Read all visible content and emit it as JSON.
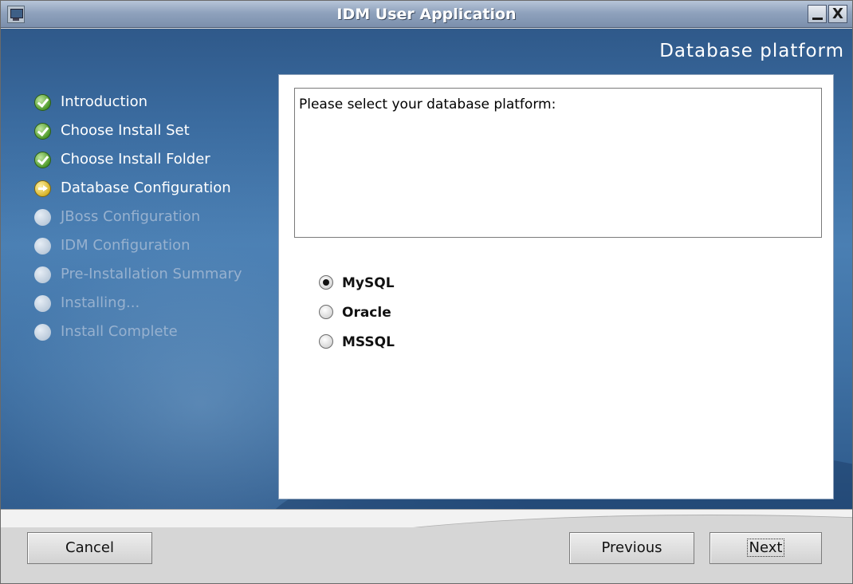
{
  "window": {
    "title": "IDM User Application",
    "minimize_label": "_",
    "close_label": "X"
  },
  "header": {
    "heading": "Database platform"
  },
  "steps": [
    {
      "label": "Introduction",
      "state": "done"
    },
    {
      "label": "Choose Install Set",
      "state": "done"
    },
    {
      "label": "Choose Install Folder",
      "state": "done"
    },
    {
      "label": "Database Configuration",
      "state": "current"
    },
    {
      "label": "JBoss Configuration",
      "state": "pending"
    },
    {
      "label": "IDM Configuration",
      "state": "pending"
    },
    {
      "label": "Pre-Installation Summary",
      "state": "pending"
    },
    {
      "label": "Installing...",
      "state": "pending"
    },
    {
      "label": "Install Complete",
      "state": "pending"
    }
  ],
  "content": {
    "instructions": "Please select your database platform:",
    "options": [
      {
        "label": "MySQL",
        "selected": true
      },
      {
        "label": "Oracle",
        "selected": false
      },
      {
        "label": "MSSQL",
        "selected": false
      }
    ]
  },
  "footer": {
    "cancel_label": "Cancel",
    "previous_label": "Previous",
    "next_label": "Next"
  },
  "colors": {
    "panel_blue": "#3b6ca0",
    "step_done": "#4f9a2c",
    "step_current": "#d6b42a",
    "step_pending_text": "#97b1cf"
  }
}
